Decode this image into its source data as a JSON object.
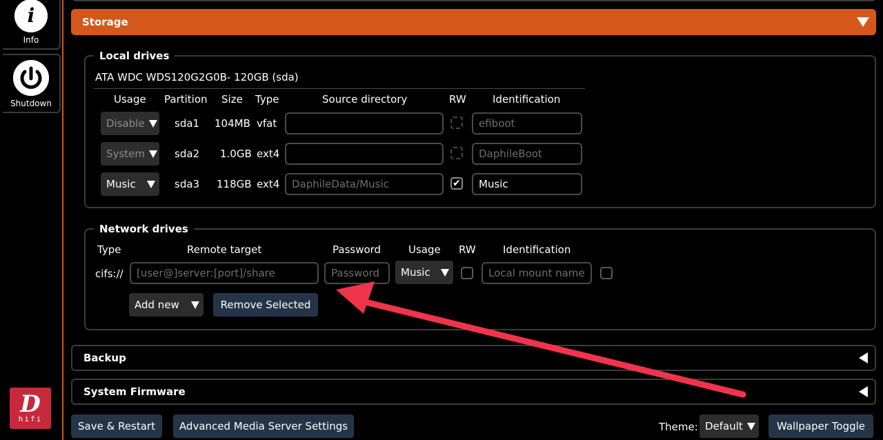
{
  "sidebar": {
    "info_label": "Info",
    "shutdown_label": "Shutdown",
    "logo_letter": "D",
    "logo_text": "hifi"
  },
  "storage": {
    "title": "Storage",
    "local": {
      "legend": "Local drives",
      "drive_name": "ATA WDC WDS120G2G0B- 120GB (sda)",
      "headers": {
        "usage": "Usage",
        "partition": "Partition",
        "size": "Size",
        "type": "Type",
        "source": "Source directory",
        "rw": "RW",
        "identification": "Identification"
      },
      "rows": [
        {
          "usage": "Disable",
          "partition": "sda1",
          "size": "104MB",
          "type": "vfat",
          "source": "",
          "rw_checked": false,
          "identification": "efiboot"
        },
        {
          "usage": "System",
          "partition": "sda2",
          "size": "1.0GB",
          "type": "ext4",
          "source": "",
          "rw_checked": false,
          "identification": "DaphileBoot"
        },
        {
          "usage": "Music",
          "partition": "sda3",
          "size": "118GB",
          "type": "ext4",
          "source": "DaphileData/Music",
          "rw_checked": true,
          "identification": "Music",
          "rw_mark": "✔"
        }
      ]
    },
    "network": {
      "legend": "Network drives",
      "headers": {
        "type": "Type",
        "remote": "Remote target",
        "password": "Password",
        "usage": "Usage",
        "rw": "RW",
        "identification": "Identification"
      },
      "row": {
        "type": "cifs://",
        "remote_placeholder": "[user@]server:[port]/share",
        "password_placeholder": "Password",
        "usage": "Music",
        "identification_placeholder": "Local mount name"
      },
      "add_new_label": "Add new",
      "remove_selected_label": "Remove Selected"
    }
  },
  "backup": {
    "title": "Backup"
  },
  "firmware": {
    "title": "System Firmware"
  },
  "footer": {
    "save_restart": "Save & Restart",
    "advanced": "Advanced Media Server Settings",
    "theme_label": "Theme:",
    "theme_value": "Default",
    "wallpaper_toggle": "Wallpaper Toggle"
  },
  "colors": {
    "accent": "#d4581c",
    "button": "#253547",
    "annotation_arrow": "#f0344c"
  },
  "icons": {
    "info": "info-icon",
    "shutdown": "power-icon",
    "collapse": "triangle-down-icon",
    "expand": "triangle-left-icon"
  }
}
